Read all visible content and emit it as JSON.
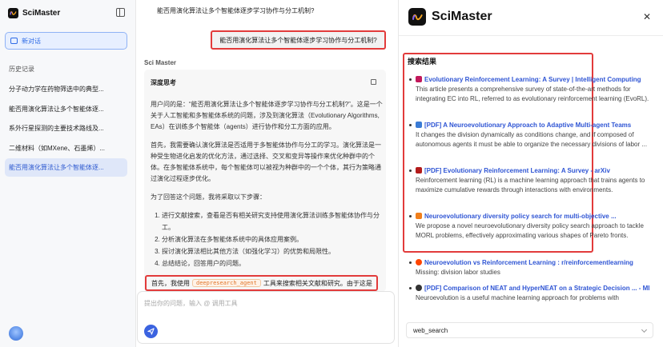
{
  "app": {
    "name": "SciMaster"
  },
  "sidebar": {
    "new_chat_label": "新对话",
    "history_title": "历史记录",
    "items": [
      {
        "label": "分子动力学在药物筛选中的典型..."
      },
      {
        "label": "能否用演化算法让多个智能体逐..."
      },
      {
        "label": "系外行星探测的主要技术路线及..."
      },
      {
        "label": "二维材料（如MXene、石墨烯）..."
      },
      {
        "label": "能否用演化算法让多个智能体逐..."
      }
    ]
  },
  "chat": {
    "title": "能否用演化算法让多个智能体逐步学习协作与分工机制?",
    "user_message": "能否用演化算法让多个智能体逐步学习协作与分工机制?",
    "assistant_label": "Sci Master",
    "deep_thinking_label": "深度思考",
    "paragraphs": [
      "用户问的是：“能否用演化算法让多个智能体逐步学习协作与分工机制?”。这是一个关于人工智能和多智能体系统的问题，涉及到演化算法（Evolutionary Algorithms, EAs）在训练多个智能体（agents）进行协作和分工方面的应用。",
      "首先，我需要确认演化算法是否适用于多智能体协作与分工的学习。演化算法是一种受生物进化启发的优化方法，通过选择、交叉和变异等操作来优化种群中的个体。在多智能体系统中，每个智能体可以被视为种群中的一个个体，其行为策略通过演化过程逐步优化。",
      "为了回答这个问题，我将采取以下步骤："
    ],
    "steps": [
      "进行文献搜索，查看是否有相关研究支持使用演化算法训练多智能体协作与分工。",
      "分析演化算法在多智能体系统中的具体应用案例。",
      "探讨演化算法相比其他方法（如强化学习）的优势和局限性。",
      "总结结论，回答用户的问题。"
    ],
    "last_line_prefix": "首先，我使用",
    "tool_name": "deepresearch_agent",
    "last_line_suffix": "工具来搜索相关文献和研究。由于这是",
    "input_placeholder": "提出你的问题，输入 @ 调用工具"
  },
  "right_panel": {
    "brand": "SciMaster",
    "results_title": "搜索结果",
    "results": [
      {
        "title": "Evolutionary Reinforcement Learning: A Survey | Intelligent Computing",
        "desc": "This article presents a comprehensive survey of state-of-the-art methods for integrating EC into RL, referred to as evolutionary reinforcement learning (EvoRL).",
        "icon": "intelligent-computing-favicon",
        "color": "#c2185b"
      },
      {
        "title": "[PDF] A Neuroevolutionary Approach to Adaptive Multi-agent Teams",
        "desc": "It changes the division dynamically as conditions change, and if composed of autonomous agents it must be able to organize the necessary divisions of labor ...",
        "icon": "pdf-document-favicon",
        "color": "#3a7bd5"
      },
      {
        "title": "[PDF] Evolutionary Reinforcement Learning: A Survey - arXiv",
        "desc": "Reinforcement learning (RL) is a machine learning approach that trains agents to maximize cumulative rewards through interactions with environments.",
        "icon": "arxiv-favicon",
        "color": "#b31b1b"
      },
      {
        "title": "Neuroevolutionary diversity policy search for multi-objective ...",
        "desc": "We propose a novel neuroevolutionary diversity policy search approach to tackle MORL problems, effectively approximating various shapes of Pareto fronts.",
        "icon": "elsevier-favicon",
        "color": "#f07f1b"
      },
      {
        "title": "Neuroevolution vs Reinforcement Learning : r/reinforcementlearning",
        "desc": "Missing: division labor studies",
        "icon": "reddit-favicon",
        "color": "#ff4500"
      },
      {
        "title": "[PDF] Comparison of NEAT and HyperNEAT on a Strategic Decision ... - MIT",
        "desc": "Neuroevolution is a useful machine learning approach for problems with",
        "icon": "mit-favicon",
        "color": "#333333"
      }
    ],
    "tool_select_value": "web_search"
  }
}
